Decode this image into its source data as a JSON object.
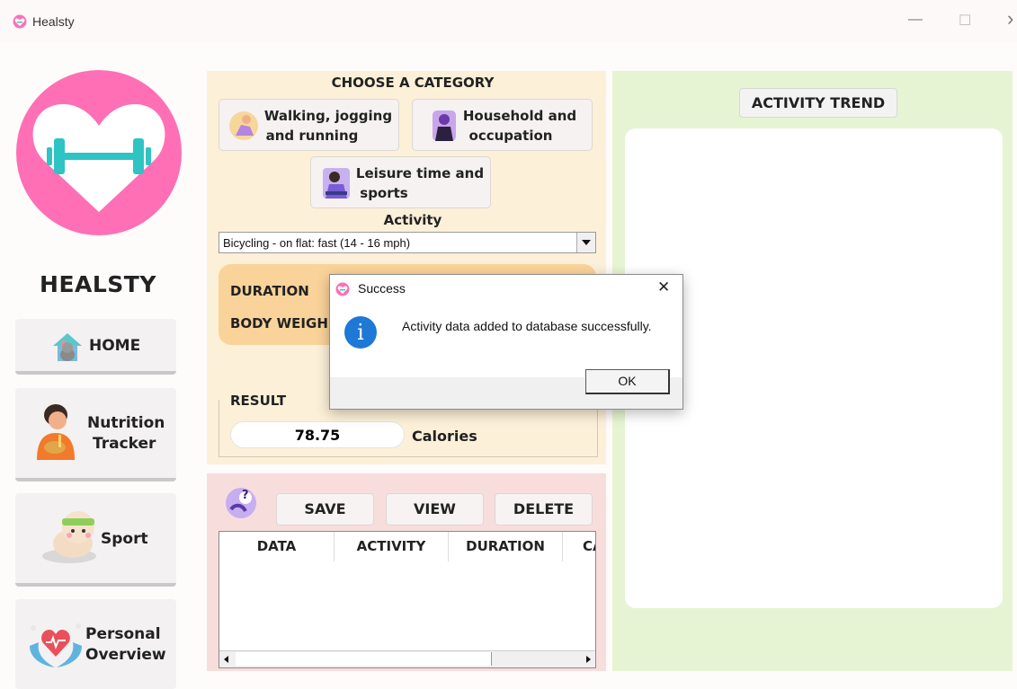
{
  "window": {
    "title": "Healsty",
    "minimize_glyph": "—",
    "maximize_glyph": "☐",
    "close_glyph": "›"
  },
  "sidebar": {
    "brand": "HEALSTY",
    "items": [
      {
        "label": "HOME",
        "icon": "house-cat-icon"
      },
      {
        "label_line1": "Nutrition",
        "label_line2": "Tracker",
        "icon": "person-eating-icon"
      },
      {
        "label": "Sport",
        "icon": "hamster-headband-icon"
      },
      {
        "label_line1": "Personal",
        "label_line2": "Overview",
        "icon": "heart-hands-icon"
      }
    ]
  },
  "category": {
    "heading": "CHOOSE A CATEGORY",
    "buttons": [
      {
        "line1": "Walking, jogging",
        "line2": "and running"
      },
      {
        "line1": "Household and",
        "line2": "occupation"
      },
      {
        "line1": "Leisure time and",
        "line2": "sports"
      }
    ],
    "activity_label": "Activity",
    "activity_selected": "Bicycling - on flat: fast (14 - 16 mph)",
    "duration_label": "DURATION",
    "weight_label": "BODY WEIGH",
    "result_label": "RESULT",
    "result_value": "78.75",
    "result_unit": "Calories"
  },
  "data_panel": {
    "help_glyph": "?",
    "save_label": "SAVE",
    "view_label": "VIEW",
    "delete_label": "DELETE",
    "columns": [
      "DATA",
      "ACTIVITY",
      "DURATION",
      "CA"
    ]
  },
  "trend": {
    "button_label": "ACTIVITY TREND"
  },
  "dialog": {
    "title": "Success",
    "message": "Activity data added to database successfully.",
    "ok_label": "OK",
    "close_glyph": "✕",
    "info_glyph": "i"
  },
  "colors": {
    "brand_pink": "#ff6fb5",
    "dumbbell_teal": "#2ec4c4",
    "category_bg": "#fcf0d8",
    "input_bg": "#fad39a",
    "data_bg": "#f7dedd",
    "trend_bg": "#e6f4d3",
    "info_blue": "#1d78d6"
  }
}
